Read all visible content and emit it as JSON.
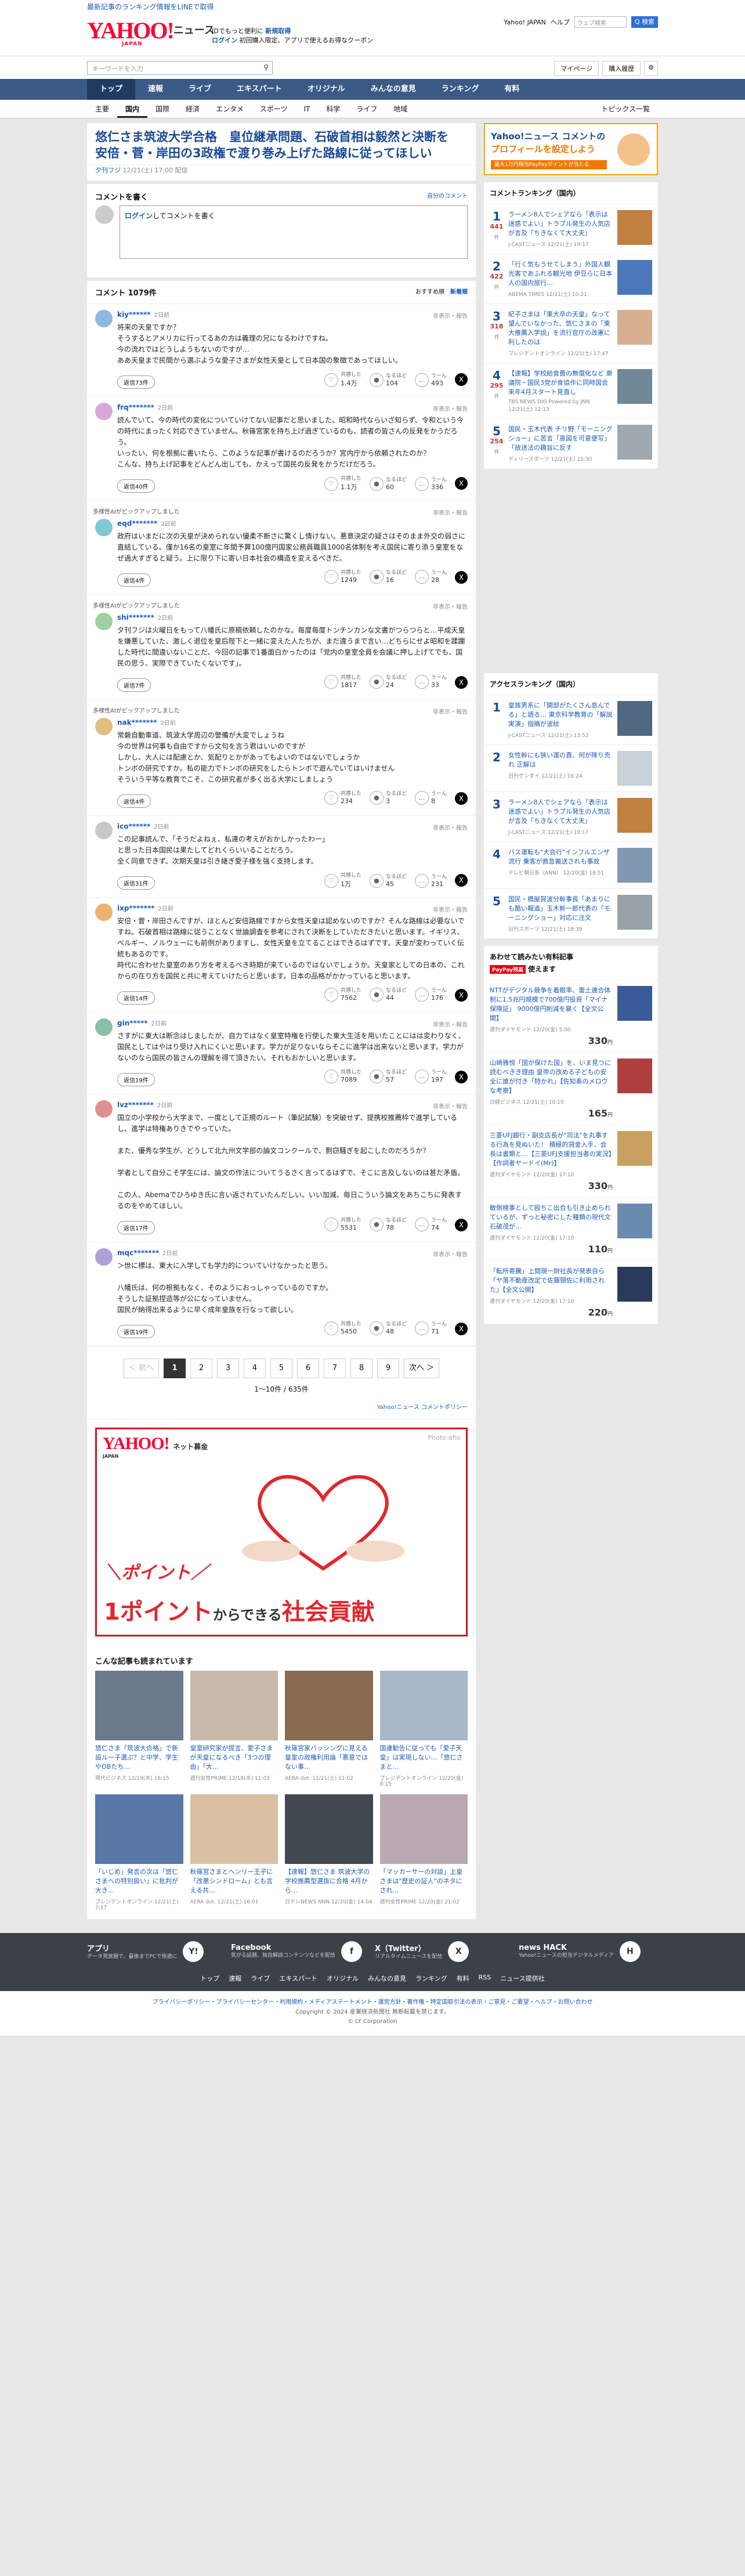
{
  "topstrip": {
    "text": "最新記事のランキング情報をLINEで取得"
  },
  "header": {
    "logo": "YAHOO!",
    "logo_sub": "JAPAN",
    "logo_news": "ニュース",
    "tag1_a": "IDでもっと便利に",
    "tag1_b": "新規取得",
    "tag2_a": "ログイン",
    "tag2_b": "初回購入限定、アプリで使えるお得なクーポン",
    "yj": "Yahoo! JAPAN",
    "help": "ヘルプ",
    "search_ph": "ウェブ検索",
    "search_btn": "Q 検索"
  },
  "bar2": {
    "keyword_ph": "キーワードを入力",
    "mypage": "マイページ",
    "history": "購入履歴"
  },
  "gnav": [
    "トップ",
    "速報",
    "ライブ",
    "エキスパート",
    "オリジナル",
    "みんなの意見",
    "ランキング",
    "有料"
  ],
  "subnav": [
    "主要",
    "国内",
    "国際",
    "経済",
    "エンタメ",
    "スポーツ",
    "IT",
    "科学",
    "ライフ",
    "地域"
  ],
  "subnav_topics": "トピックス一覧",
  "article": {
    "title": "悠仁さま筑波大学合格　皇位継承問題、石破首相は毅然と決断を　安倍・菅・岸田の3政権で渡り巻み上げた路線に従ってほしい",
    "source": "夕刊フジ",
    "date": "12/21(土) 17:00 配信"
  },
  "compose": {
    "heading": "コメントを書く",
    "policy": "自分のコメント",
    "login": "ログイン",
    "placeholder": "してコメントを書く"
  },
  "comments_head": {
    "title": "コメント 1079件",
    "sort1": "おすすめ順",
    "sort2": "新着順"
  },
  "reactions": {
    "like": "共感した",
    "hmm": "なるほど",
    "think": "うーん"
  },
  "comments": [
    {
      "user": "kiy******",
      "ago": "2日前",
      "report": "非表示・報告",
      "ai": "",
      "text": "将来の天皇ですか？\nそうするとアメリカに行ってるあの方は義理の兄になるわけですね。\n今の流れではどうしようもないのですが…\nああ天皇まで民間から選ぶような愛子さまが女性天皇として日本国の象徴であってほしい。",
      "replies": "返信73件",
      "like": "1.4万",
      "hmm": "104",
      "think": "493",
      "color": "#8fb8e0"
    },
    {
      "user": "frq*******",
      "ago": "2日前",
      "report": "非表示・報告",
      "ai": "",
      "text": "読んでいて、今の時代の変化についていけてない記事だと思いました。昭和時代ならいざ知らず、令和という今の時代にまったく対応できていません。秋篠宮家を持ち上げ過ぎているのも、読者の皆さんの反発をかうだろう。\nいったい、何を根拠に書いたら、このような記事が書けるのだろうか？宮内庁から依頼されたのか？\nこんな、持ち上げ記事をどんどん出しても、かえって国民の反発をかうだけだろう。",
      "replies": "返信40件",
      "like": "1.1万",
      "hmm": "60",
      "think": "336",
      "color": "#d6a8d8"
    },
    {
      "user": "eqd*******",
      "ago": "2日前",
      "report": "非表示・報告",
      "ai": "多様性AIがピックアップしました",
      "text": "政府はいまだに次の天皇が決められない優柔不断さに驚くし情けない。悪意決定の疑さはそのまま外交の弱さに直結している。僅か16名の皇室に年間予算100億円国家公務員職員1000名体制を考え国民に寄り添う皇室をなぜ過大すぎると疑う。上に限り下に寄い日本社会の構造を変えるべきだ。",
      "replies": "返信4件",
      "like": "1249",
      "hmm": "16",
      "think": "28",
      "color": "#7fc8d8"
    },
    {
      "user": "shi*******",
      "ago": "2日前",
      "report": "非表示・報告",
      "ai": "多様性AIがピックアップしました",
      "text": "夕刊フジは火曜日をもって八幡氏に原稿依頼したのかな。毎度毎度トンチンカンな文書がつらつらと…平成天皇を嫌悪していた、激しく退位を皇后陛下と一緒に変えた人たちが、まだ違うまで言い…どちらにせよ昭和を蹂躙した時代に間違いないことだ、今回の記事で1番面白かったのは「党内の皇室全員を会議に押し上げてでも、国民の思う、実際できていたくないです」。",
      "replies": "返信7件",
      "like": "1817",
      "hmm": "24",
      "think": "33",
      "color": "#a0d0a0"
    },
    {
      "user": "nak*******",
      "ago": "2日前",
      "report": "非表示・報告",
      "ai": "多様性AIがピックアップしました",
      "text": "常磐自動車道、筑波大学周辺の警備が大変でしょうね\n今の世界は何事も自由ですから文句を言う君はいいのですが\nしかし、大人には配慮とか、気配りとかがあってもよいのではないでしょうか\nトンボの研究ですか。私の能力でトンボの研究をしたらトンボで遊んでいてはいけません\nそういう平等な教育でこそ、この研究者が多く出る大学にしましょう",
      "replies": "返信4件",
      "like": "234",
      "hmm": "3",
      "think": "8",
      "color": "#e0c080"
    },
    {
      "user": "ico******",
      "ago": "2日前",
      "report": "非表示・報告",
      "ai": "",
      "text": "この記事読んで、「そうだよねぇ、私達の考えがおかしかったわー」\nと思った日本国民は果たしてどれくらいいることだろう。\n全く同意できず。次期天皇は引き継ぎ愛子様を強く支持します。",
      "replies": "返信31件",
      "like": "1万",
      "hmm": "45",
      "think": "231",
      "color": "#c8c8c8"
    },
    {
      "user": "ixp*******",
      "ago": "2日前",
      "report": "非表示・報告",
      "ai": "",
      "text": "安倍・菅・岸田さんですが、ほとんど安倍路線ですから女性天皇は認めないのですか？そんな路線は必要ないですね。石破首相は路線に従うことなく世論調査を参考にされて決断をしていただきたいと思います。イギリス、ベルギー、ノルウェーにも前例がありますし、女性天皇を立てることはできるはずです。天皇が変わっていく伝統もあるのです。\n時代に合わせた皇室のあり方を考えるべき時期が来ているのではないでしょうか。天皇家としての日本の、これからの在り方を国民と共に考えていけたらと思います。日本の品格がかかっていると思います。",
      "replies": "返信14件",
      "like": "7562",
      "hmm": "44",
      "think": "176",
      "color": "#f0b070"
    },
    {
      "user": "gin*****",
      "ago": "2日前",
      "report": "非表示・報告",
      "ai": "",
      "text": "さすがに東大は断念はしましたが、自力ではなく皇室特権を行使した東大生活を用いたことにはは変わりなく、国民としてはやはり受け入れにくいと思います。学力が足りないならそこに進学は出来ないと思います。学力がないのなら国民の皆さんの理解を得て頂きたい。それもおかしいと思います。",
      "replies": "返信19件",
      "like": "7089",
      "hmm": "57",
      "think": "197",
      "color": "#88c0a8"
    },
    {
      "user": "lvz*******",
      "ago": "2日前",
      "report": "非表示・報告",
      "ai": "",
      "text": "国立の小学校から大学まで、一度として正規のルート（筆記試験）を突破せず、提携校推薦枠で進学しているし、進学は特権ありきでやっていた。\n\nまた、優秀な学生が、どうして北九州文学部の論文コンクールで、剽窃騒ぎを起こしたのだろうか？\n\n学者として自分こそ学生には、論文の作法についてうるさく言ってるはずで、そこに言及しないのは甚だ矛盾。\n\nこの人、Abemaでひろゆき氏に言い返されていたんだしい。いい加減、毎日こういう論文をあちこちに発表するのをやめてほしい。",
      "replies": "返信17件",
      "like": "5531",
      "hmm": "78",
      "think": "74",
      "color": "#e09090"
    },
    {
      "user": "mqc*******",
      "ago": "2日前",
      "report": "非表示・報告",
      "ai": "",
      "text": "＞世に標は、東大に入学しても学力的についていけなかったと思う。\n\n八幡氏は、何の根拠もなく、そのようにおっしゃっているのですか。\nそうした証拠捏造等が公になっていません。\n国民が納得出来るように早く成年皇族を行なって欲しい。",
      "replies": "返信19件",
      "like": "5450",
      "hmm": "48",
      "think": "71",
      "color": "#b0a0d8"
    }
  ],
  "pager": {
    "prev": "＜ 前へ",
    "pages": [
      "1",
      "2",
      "3",
      "4",
      "5",
      "6",
      "7",
      "8",
      "9"
    ],
    "next": "次へ ＞",
    "count": "1〜10件 / 635件",
    "policy": "Yahoo!ニュース コメントポリシー"
  },
  "ad": {
    "logo": "YAHOO!",
    "logo_sub": "JAPAN",
    "logo_tag": "ネット募金",
    "caption": "Photo:afio",
    "line1": "＼ポイント／",
    "line2a": "1ポイント",
    "line2b": "からできる",
    "line2c": "社会貢献"
  },
  "reads": {
    "title": "こんな記事も読まれています",
    "items": [
      {
        "t": "悠仁さま「筑波大合格」で新設ルー子選ぶ？と中学、学生やOBたち…",
        "s": "現代ビジネス 12/19(木) 16:15",
        "c": "#6a7a8a"
      },
      {
        "t": "皇室研究家が提言、愛子さまが天皇になるべき「3つの理由」「大…",
        "s": "週刊女性PRIME 12/18(水) 11:03",
        "c": "#c8b8a8"
      },
      {
        "t": "秋篠宮家バッシングに見える皇室の政権利用論「悪意ではない事…",
        "s": "AERA dot. 12/21(土) 11:02",
        "c": "#8a6a50"
      },
      {
        "t": "国連勧告に従っても「愛子天皇」は実現しない…「悠仁さまと…",
        "s": "プレジデントオンライン 12/20(金) 8:15",
        "c": "#a8b8c8"
      },
      {
        "t": "「いじめ」発言の次は「悠仁さまへの特別扱い」に批判が大き…",
        "s": "プレジデントオンライン 12/21(土) 7:17",
        "c": "#5878a8"
      },
      {
        "t": "秋篠宮さまとヘンリー王子に「改悪シンドローム」とも言える共…",
        "s": "AERA dot. 12/21(土) 16:01",
        "c": "#d8c0a0"
      },
      {
        "t": "【速報】悠仁さま 筑波大学の学校推薦型選抜に合格 4月から…",
        "s": "日テレNEWS NNN 12/20(金) 14:04",
        "c": "#404850"
      },
      {
        "t": "「マッカーサーの対談」上皇さまは\"歴史の証人\"のネタにされ…",
        "s": "週刊女性PRIME 12/20(金) 21:02",
        "c": "#b8a8b0"
      }
    ]
  },
  "side_ad": {
    "line1": "Yahoo!ニュース コメントの",
    "line2": "プロフィールを設定しよう",
    "bar": "最大1万円相当PayPayポイントが当たる"
  },
  "comment_ranking": {
    "title": "コメントランキング（国内）",
    "items": [
      {
        "n": "1",
        "c": "441",
        "ci": "件",
        "t": "ラーメン8人でシェアなら「表示は迷惑でよい」トラブル発生の人気店が言及「ちきなくて大丈夫」",
        "s": "J-CASTニュース 12/21(土) 19:17",
        "color": "#c08040"
      },
      {
        "n": "2",
        "c": "422",
        "ci": "件",
        "t": "「行く気もうせてしまう」外国人観光客であふれる観光地 伊豆らに日本人の国内旅行…",
        "s": "ABEMA TIMES 12/21(土) 10:21",
        "color": "#4a78b8"
      },
      {
        "n": "3",
        "c": "318",
        "ci": "件",
        "t": "紀子さまは「東大卒の天皇」なって望んでいなかった、悠仁さまの「東大推薦入学説」を流行官庁の改憲に利したのは",
        "s": "プレジデントオンライン 12/21(土) 17:47",
        "color": "#d8b090"
      },
      {
        "n": "4",
        "c": "295",
        "ci": "件",
        "t": "【速報】学校給食費の無償化など 衆議院・国民3党が食協作に同時国会 来年4月スタート見直し",
        "s": "TBS NEWS DIG Powered by JNN 12/21(土) 12:13",
        "color": "#708898"
      },
      {
        "n": "5",
        "c": "254",
        "ci": "件",
        "t": "国民・玉木代表 チリ野「モーニングショー」に苦言「意図を可意便写」「放送法の趣旨に反す",
        "s": "ディリースポーツ 12/21(土) 15:30",
        "color": "#a0a8b0"
      }
    ]
  },
  "access_ranking": {
    "title": "アクセスランキング（国内）",
    "items": [
      {
        "n": "1",
        "t": "皇族男系に「開部がたくさん息んでる」と語る… 東京科学教育の「解説実演」指摘が波紋",
        "s": "J-CASTニュース 12/21(土) 13:53",
        "color": "#506880"
      },
      {
        "n": "2",
        "t": "女性幹にも狭い運の責、何が降り売れ 正解は",
        "s": "日刊ゲンダイ 12/21(土) 16:24",
        "color": "#c8d0d8"
      },
      {
        "n": "3",
        "t": "ラーメン8人でシェアなら「表示は迷惑でよい」トラブル発生の人気店が言及「ちきなくて大丈夫」",
        "s": "J-CASTニュース 12/21(土) 19:17",
        "color": "#c08040"
      },
      {
        "n": "4",
        "t": "バス運転も\"大会行\"インフルエンザ流行 乗客が救急搬送されも事故",
        "s": "テレビ朝日系（ANN） 12/20(金) 18:51",
        "color": "#8098b0"
      },
      {
        "n": "5",
        "t": "国民・橋屋賀波分幹事長「あまりにも酷い報道」玉木幹一郎代表の「モーニングショー」対応に注文",
        "s": "日刊スポーツ 12/21(土) 18:39",
        "color": "#98a0a8"
      }
    ]
  },
  "paypay": {
    "title": "あわせて読みたい有料記事",
    "badge": "PayPay残高",
    "badge_tail": "使えます",
    "items": [
      {
        "t": "NTTがデジタル競争を着眼率、雷土連合体制に1.5兆円規模で700億円投資「マイナ保険証」 9000億円削減を暴く【全文公開】",
        "s": "週刊ダイヤモンド 12/20(金) 5:00",
        "p": "330",
        "color": "#3a5a9a"
      },
      {
        "t": "山崎雅悦「国が保けた国」を、いま見つに読むべきき理由 皇帝の改める子どもの安全に誰が付き「特かれ」【佐知奏のメロウな考察】",
        "s": "日経ビジネス 12/21(土) 10:10",
        "p": "165",
        "color": "#b04040"
      },
      {
        "t": "三菱UFJ銀行・副支店長が\"司法\"を丸事する行為を見ぬいた！ 積極的貸金入手、会長は書類と…【三菱UFJ支援担当者の実況】【作詞者ヤードイ(Mr)】",
        "s": "週刊ダイヤモンド 12/20(金) 17:10",
        "p": "330",
        "color": "#c8a060"
      },
      {
        "t": "敏側検事として殴ちこ出合も引き止められているが、ずっと秘密にした種類の現代文 石破茂が…",
        "s": "週刊ダイヤモンド 12/20(金) 17:10",
        "p": "110",
        "color": "#6a8ab0"
      },
      {
        "t": "「転所寄騰」上間現一財社長が発表自ら「ヤ落不動産改定で佐藤頸佐に利用された」【全文公開】",
        "s": "週刊ダイヤモンド 12/20(金) 17:10",
        "p": "220",
        "color": "#2a3a5a"
      }
    ],
    "yen": "円"
  },
  "footer": {
    "items": [
      {
        "t": "アプリ",
        "d": "データ見放題で、最後までPCで快適に",
        "icon": "Y!"
      },
      {
        "t": "Facebook",
        "d": "気がる話題、独自解説コンテンツなどを配信",
        "icon": "f"
      },
      {
        "t": "X（Twitter）",
        "d": "リアルタイムニュースを配信",
        "icon": "X"
      },
      {
        "t": "news HACK",
        "d": "Yahoo!ニュースの担当デジタルメディア",
        "icon": "H"
      }
    ],
    "links": [
      "トップ",
      "速報",
      "ライブ",
      "エキスパート",
      "オリジナル",
      "みんなの意見",
      "ランキング",
      "有料",
      "RSS",
      "ニュース提供社"
    ],
    "legal": "プライバシーポリシー・プライバシーセンター・利用規約・メディアステートメント・運営方針・著作権・特定国取引法の表示・ご意見・ご要望・ヘルプ・お問い合わせ",
    "copy1": "Copyright © 2024 産業経済新聞社 無断転載を禁じます。",
    "copy2": "© LY Corporation"
  },
  "colors": {
    "accent": "#1a5bb5",
    "nav": "#3b5a86",
    "brand_red": "#ff0033"
  }
}
